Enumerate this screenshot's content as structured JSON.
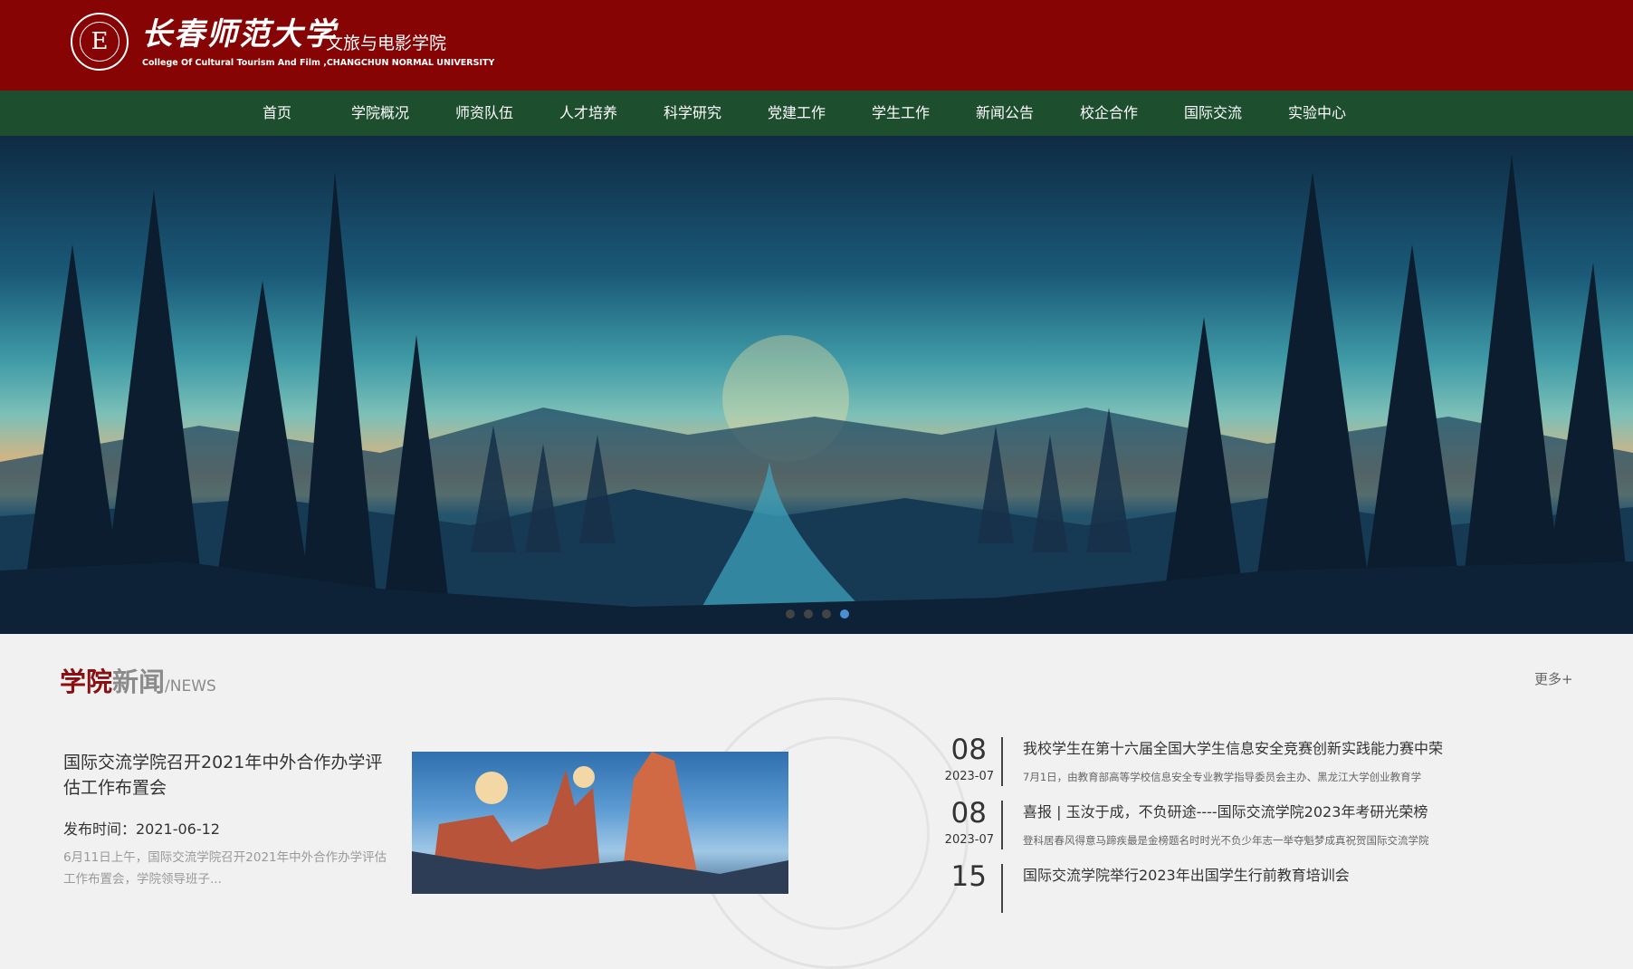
{
  "header": {
    "school_name": "长春师范大学",
    "college_name": "文旅与电影学院",
    "english_name": "College Of Cultural Tourism And Film ,CHANGCHUN NORMAL UNIVERSITY",
    "emblem_glyph": "E",
    "background_color": "#870404"
  },
  "nav": {
    "background_color": "#1d4f2f",
    "items": [
      "首页",
      "学院概况",
      "师资队伍",
      "人才培养",
      "科学研究",
      "党建工作",
      "学生工作",
      "新闻公告",
      "校企合作",
      "国际交流",
      "实验中心"
    ]
  },
  "banner": {
    "slide_count": 4,
    "active_slide": 4
  },
  "news_section": {
    "title_red": "学院",
    "title_gray": "新闻",
    "title_en": "/NEWS",
    "more_label": "更多+",
    "feature": {
      "title": "国际交流学院召开2021年中外合作办学评估工作布置会",
      "date_label": "发布时间：2021-06-12",
      "summary": "6月11日上午，国际交流学院召开2021年中外合作办学评估工作布置会，学院领导班子..."
    },
    "list": [
      {
        "day": "08",
        "year_month": "2023-07",
        "title": "我校学生在第十六届全国大学生信息安全竞赛创新实践能力赛中荣",
        "summary": "7月1日，由教育部高等学校信息安全专业教学指导委员会主办、黑龙江大学创业教育学"
      },
      {
        "day": "08",
        "year_month": "2023-07",
        "title": "喜报 | 玉汝于成，不负研途----国际交流学院2023年考研光荣榜",
        "summary": "登科居春风得意马蹄疾最是金榜题名时时光不负少年志一举夺魁梦成真祝贺国际交流学院"
      },
      {
        "day": "15",
        "year_month": "",
        "title": "国际交流学院举行2023年出国学生行前教育培训会",
        "summary": ""
      }
    ]
  }
}
